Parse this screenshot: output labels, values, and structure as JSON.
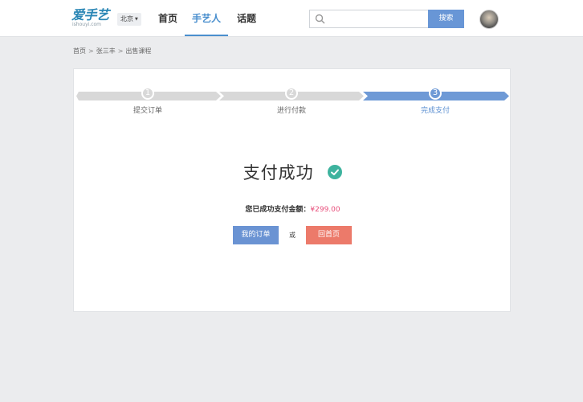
{
  "header": {
    "logo_main": "爱手艺",
    "logo_sub": "ishouyi.com",
    "city": "北京",
    "nav": [
      {
        "label": "首页"
      },
      {
        "label": "手艺人",
        "active": true
      },
      {
        "label": "话题"
      }
    ],
    "search": {
      "placeholder": "",
      "value": "",
      "button_label": "搜索"
    },
    "accent_color": "#6896d6"
  },
  "breadcrumb": {
    "items": [
      "首页",
      "张三丰",
      "出售课程"
    ],
    "separator": ">"
  },
  "steps": [
    {
      "num": "1",
      "label": "提交订单",
      "active": false
    },
    {
      "num": "2",
      "label": "进行付款",
      "active": false
    },
    {
      "num": "3",
      "label": "完成支付",
      "active": true
    }
  ],
  "result": {
    "title": "支付成功",
    "amount_label": "您已成功支付金额：",
    "amount_value": "¥299.00",
    "amount_color": "#e8507c",
    "success_color": "#3db39e"
  },
  "actions": {
    "orders_label": "我的订单",
    "or_label": "或",
    "home_label": "回首页",
    "orders_color": "#6a93d3",
    "home_color": "#ec7a6a"
  }
}
